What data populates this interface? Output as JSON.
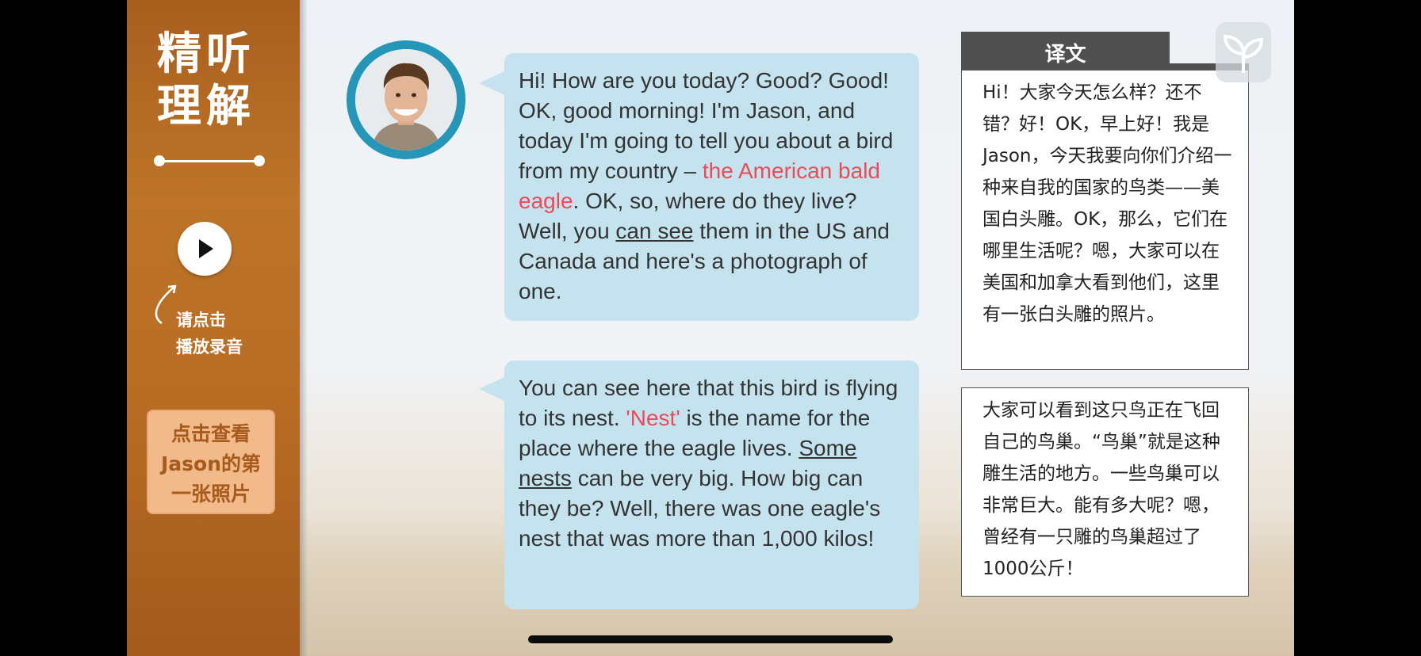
{
  "sidebar": {
    "title_line1": "精听",
    "title_line2": "理解",
    "play_hint_line1": "请点击",
    "play_hint_line2": "播放录音",
    "photo_button_line1": "点击查看",
    "photo_button_line2": "Jason的第",
    "photo_button_line3": "一张照片"
  },
  "dialogue": {
    "bubble1": {
      "t1": "Hi! How are you today? Good? Good! OK, good morning! I'm Jason, and today I'm going to tell you about a bird from my country – ",
      "t2": "the American bald eagle",
      "t3": ". OK, so, where do they live? Well, you ",
      "t4": "can see",
      "t5": " them in the US and Canada and here's a photograph of one."
    },
    "bubble2": {
      "t1": "You can see here that this bird is flying to its nest. ",
      "t2": "'Nest'",
      "t3": " is the name for the place where the eagle lives. ",
      "t4": "Some nests",
      "t5": " can be very big. How big can they be? Well, there was one eagle's nest that was more than 1,000 kilos!"
    }
  },
  "translation": {
    "tab_label": "译文",
    "para1": "Hi！大家今天怎么样？还不错？好！OK，早上好！我是Jason，今天我要向你们介绍一种来自我的国家的鸟类——美国白头雕。OK，那么，它们在哪里生活呢？嗯，大家可以在美国和加拿大看到他们，这里有一张白头雕的照片。",
    "para2": "大家可以看到这只鸟正在飞回自己的鸟巢。“鸟巢”就是这种雕生活的地方。一些鸟巢可以非常巨大。能有多大呢？嗯，曾经有一只雕的鸟巢超过了1000公斤！"
  },
  "colors": {
    "sidebar": "#b86d24",
    "bubble": "#c5e3ee",
    "highlight": "#ec4a57",
    "avatar_ring": "#2596b8",
    "tab": "#505050"
  },
  "icons": [
    "play-icon",
    "curved-arrow-icon",
    "sprout-logo-icon",
    "avatar-photo"
  ]
}
